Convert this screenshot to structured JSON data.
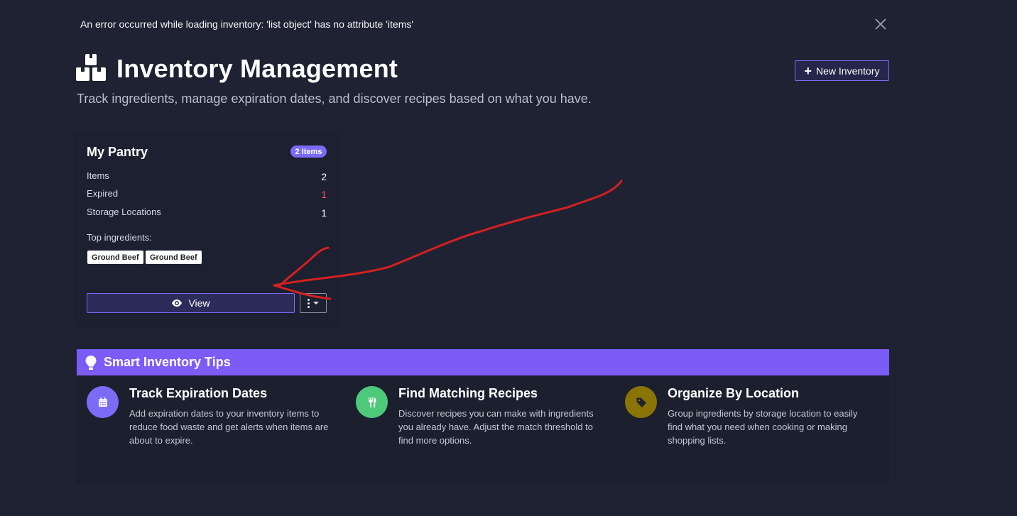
{
  "alert": {
    "message": "An error occurred while loading inventory: 'list object' has no attribute 'items'",
    "close_icon": "close-icon"
  },
  "header": {
    "icon": "boxes-icon",
    "title": "Inventory Management",
    "subtitle": "Track ingredients, manage expiration dates, and discover recipes based on what you have.",
    "new_button": "New Inventory"
  },
  "card": {
    "title": "My Pantry",
    "badge": "2 Items",
    "stats": [
      {
        "label": "Items",
        "value": "2"
      },
      {
        "label": "Expired",
        "value": "1"
      },
      {
        "label": "Storage Locations",
        "value": "1"
      }
    ],
    "top_label": "Top ingredients:",
    "ingredients": [
      "Ground Beef",
      "Ground Beef"
    ],
    "view_button": "View"
  },
  "tips": {
    "title": "Smart Inventory Tips",
    "items": [
      {
        "title": "Track Expiration Dates",
        "description": "Add expiration dates to your inventory items to reduce food waste and get alerts when items are about to expire.",
        "icon": "calendar-icon",
        "color": "#7b6cf6"
      },
      {
        "title": "Find Matching Recipes",
        "description": "Discover recipes you can make with ingredients you already have. Adjust the match threshold to find more options.",
        "icon": "utensils-icon",
        "color": "#4ec97a"
      },
      {
        "title": "Organize By Location",
        "description": "Group ingredients by storage location to easily find what you need when cooking or making shopping lists.",
        "icon": "tag-icon",
        "color": "#8a7406"
      }
    ]
  },
  "colors": {
    "accent": "#7b6cf6",
    "danger": "#f2545b",
    "background": "#1e2232",
    "annotation": "#d42020"
  }
}
